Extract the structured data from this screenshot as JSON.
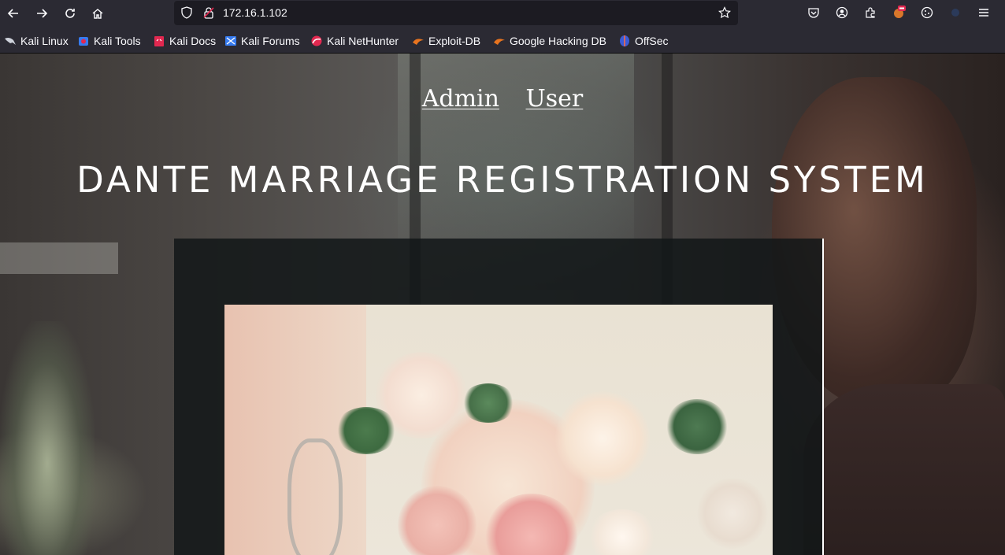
{
  "browser": {
    "url": "172.16.1.102",
    "bookmarks": [
      {
        "label": "Kali Linux",
        "icon": "kali-dragon-icon"
      },
      {
        "label": "Kali Tools",
        "icon": "kali-tools-icon"
      },
      {
        "label": "Kali Docs",
        "icon": "kali-docs-icon"
      },
      {
        "label": "Kali Forums",
        "icon": "kali-forums-icon"
      },
      {
        "label": "Kali NetHunter",
        "icon": "kali-nethunter-icon"
      },
      {
        "label": "Exploit-DB",
        "icon": "exploit-db-icon"
      },
      {
        "label": "Google Hacking DB",
        "icon": "ghdb-icon"
      },
      {
        "label": "OffSec",
        "icon": "offsec-icon"
      }
    ]
  },
  "page": {
    "nav": {
      "admin": "Admin",
      "user": "User"
    },
    "title": "DANTE MARRIAGE REGISTRATION SYSTEM"
  },
  "colors": {
    "chrome_bg": "#2b2a33",
    "urlbar_bg": "#1c1b22",
    "text": "#fbfbfe",
    "panel_bg": "#121618"
  }
}
